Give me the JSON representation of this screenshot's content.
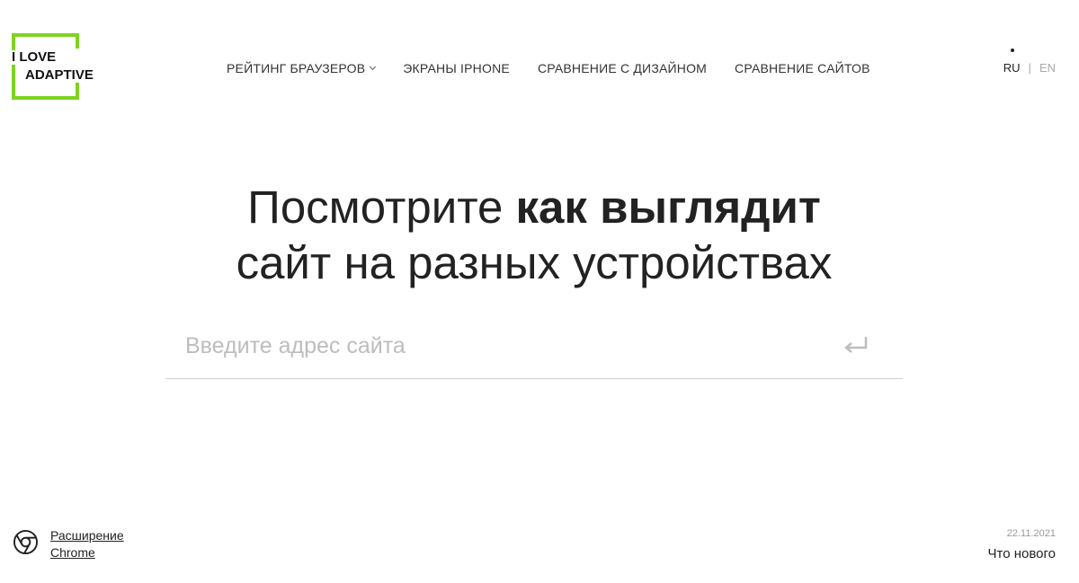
{
  "colors": {
    "accent": "#7ed321",
    "text": "#222222",
    "muted": "#aaaaaa",
    "placeholder": "#bdbdbd"
  },
  "logo": {
    "line1": "I LOVE",
    "line2": "ADAPTIVE"
  },
  "nav": {
    "items": [
      {
        "label": "РЕЙТИНГ БРАУЗЕРОВ",
        "icon": "chevron-down-icon"
      },
      {
        "label": "ЭКРАНЫ IPHONE"
      },
      {
        "label": "СРАВНЕНИЕ С ДИЗАЙНОМ"
      },
      {
        "label": "СРАВНЕНИЕ САЙТОВ"
      }
    ]
  },
  "lang": {
    "current": "RU",
    "separator": "|",
    "other": "EN"
  },
  "hero": {
    "part1": "Посмотрите ",
    "bold": "как выглядит",
    "line2": "сайт на разных устройствах"
  },
  "search": {
    "value": "",
    "placeholder": "Введите адрес сайта",
    "submit_icon": "enter-icon"
  },
  "extension": {
    "icon": "chrome-icon",
    "line1": "Расширение",
    "line2": "Chrome"
  },
  "news": {
    "date": "22.11.2021",
    "label": "Что нового"
  }
}
